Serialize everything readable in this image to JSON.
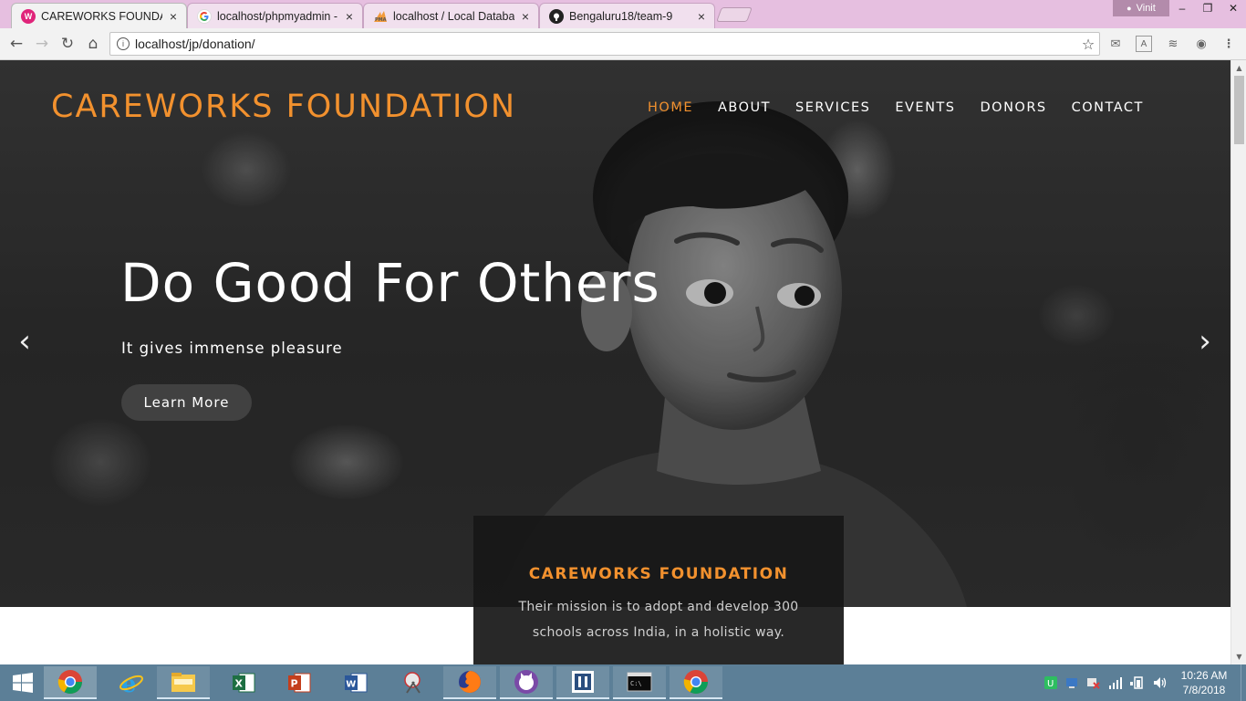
{
  "browser": {
    "tabs": [
      {
        "title": "CAREWORKS FOUNDATIO",
        "favicon": "careworks-icon",
        "active": true
      },
      {
        "title": "localhost/phpmyadmin -",
        "favicon": "google-icon",
        "active": false
      },
      {
        "title": "localhost / Local Databas",
        "favicon": "phpmyadmin-icon",
        "active": false
      },
      {
        "title": "Bengaluru18/team-9",
        "favicon": "github-icon",
        "active": false
      }
    ],
    "close_glyph": "×",
    "profile_name": "Vinit",
    "url": "localhost/jp/donation/"
  },
  "site": {
    "brand": "CAREWORKS FOUNDATION",
    "nav": [
      "HOME",
      "ABOUT",
      "SERVICES",
      "EVENTS",
      "DONORS",
      "CONTACT"
    ],
    "active_nav": "HOME",
    "hero": {
      "headline": "Do Good For Others",
      "subheadline": "It gives immense pleasure",
      "cta": "Learn More"
    },
    "infobox": {
      "title": "CAREWORKS FOUNDATION",
      "text": "Their mission is to adopt and develop 300 schools across India, in a holistic way."
    },
    "colors": {
      "accent": "#f2912e",
      "hero_overlay": "#2e2e2e",
      "infobox_bg": "#181818"
    }
  },
  "taskbar": {
    "apps": [
      "chrome-icon",
      "internet-explorer-icon",
      "file-explorer-icon",
      "excel-icon",
      "powerpoint-icon",
      "word-icon",
      "snipping-tool-icon",
      "firefox-icon",
      "github-desktop-icon",
      "sourcetree-icon",
      "command-prompt-icon",
      "chrome-icon"
    ],
    "clock_time": "10:26 AM",
    "clock_date": "7/8/2018"
  }
}
